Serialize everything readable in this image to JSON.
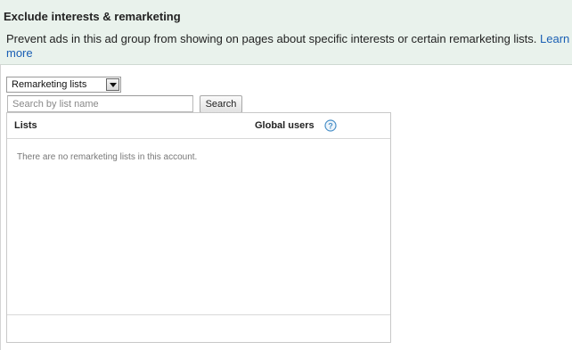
{
  "section": {
    "title": "Exclude interests & remarketing",
    "description": "Prevent ads in this ad group from showing on pages about specific interests or certain remarketing lists. ",
    "learn_more": "Learn more"
  },
  "filter": {
    "selected": "Remarketing lists"
  },
  "search": {
    "placeholder": "Search by list name",
    "value": "",
    "button_label": "Search"
  },
  "table": {
    "columns": [
      "Lists",
      "Global users"
    ],
    "empty_message": "There are no remarketing lists in this account."
  },
  "icons": {
    "help": "help-icon",
    "dropdown": "chevron-down-icon"
  },
  "colors": {
    "header_background": "#e9f2ec",
    "link": "#1a5fb4",
    "help_icon": "#4a90c8"
  }
}
